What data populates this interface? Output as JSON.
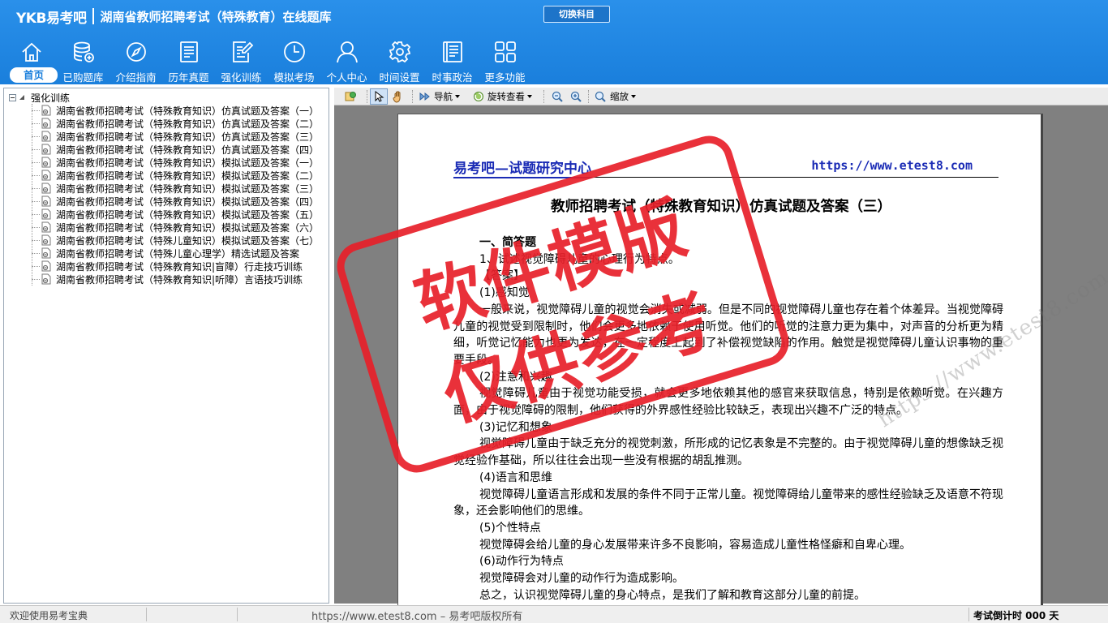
{
  "app": {
    "logo": "YKB易考吧",
    "title": "湖南省教师招聘考试（特殊教育）在线题库",
    "switch_label": "切换科目"
  },
  "nav": [
    {
      "label": "首页",
      "icon": "home-icon"
    },
    {
      "label": "已购题库",
      "icon": "database-icon"
    },
    {
      "label": "介绍指南",
      "icon": "compass-icon"
    },
    {
      "label": "历年真题",
      "icon": "list-document-icon"
    },
    {
      "label": "强化训练",
      "icon": "edit-document-icon"
    },
    {
      "label": "模拟考场",
      "icon": "clock-icon"
    },
    {
      "label": "个人中心",
      "icon": "user-icon"
    },
    {
      "label": "时间设置",
      "icon": "gear-icon"
    },
    {
      "label": "时事政治",
      "icon": "newspaper-icon"
    },
    {
      "label": "更多功能",
      "icon": "grid-icon"
    }
  ],
  "tree": {
    "root": "强化训练",
    "items": [
      "湖南省教师招聘考试（特殊教育知识）仿真试题及答案（一）",
      "湖南省教师招聘考试（特殊教育知识）仿真试题及答案（二）",
      "湖南省教师招聘考试（特殊教育知识）仿真试题及答案（三）",
      "湖南省教师招聘考试（特殊教育知识）仿真试题及答案（四）",
      "湖南省教师招聘考试（特殊教育知识）模拟试题及答案（一）",
      "湖南省教师招聘考试（特殊教育知识）模拟试题及答案（二）",
      "湖南省教师招聘考试（特殊教育知识）模拟试题及答案（三）",
      "湖南省教师招聘考试（特殊教育知识）模拟试题及答案（四）",
      "湖南省教师招聘考试（特殊教育知识）模拟试题及答案（五）",
      "湖南省教师招聘考试（特殊教育知识）模拟试题及答案（六）",
      "湖南省教师招聘考试（特殊儿童知识）模拟试题及答案（七）",
      "湖南省教师招聘考试（特殊儿童心理学）精选试题及答案",
      "湖南省教师招聘考试（特殊教育知识|盲障）行走技巧训练",
      "湖南省教师招聘考试（特殊教育知识|听障）言语技巧训练"
    ]
  },
  "toolbar": {
    "navigate": "导航",
    "rotate": "旋转查看",
    "zoom": "缩放"
  },
  "document": {
    "header_left": "易考吧—试题研究中心",
    "header_right": "https://www.etest8.com",
    "title": "教师招聘考试（特殊教育知识）仿真试题及答案（三）",
    "lines": [
      {
        "type": "sec",
        "text": "一、简答题"
      },
      {
        "type": "sub",
        "text": "1、试述视觉障碍儿童的心理行为特点。"
      },
      {
        "type": "sub",
        "text": "【答案】"
      },
      {
        "type": "sub",
        "text": "(1)感知觉"
      },
      {
        "type": "para",
        "text": "一般来说，视觉障碍儿童的视觉会消失或减弱。但是不同的视觉障碍儿童也存在着个体差异。当视觉障碍儿童的视觉受到限制时，他们会更多地依赖于使用听觉。他们的听觉的注意力更为集中，对声音的分析更为精细，听觉记忆能力也更为发达，在一定程度上起到了补偿视觉缺陷的作用。触觉是视觉障碍儿童认识事物的重要手段。"
      },
      {
        "type": "sub",
        "text": "(2)注意和兴趣"
      },
      {
        "type": "para",
        "text": "视觉障碍儿童由于视觉功能受损，就会更多地依赖其他的感官来获取信息，特别是依赖听觉。在兴趣方面，由于视觉障碍的限制，他们获得的外界感性经验比较缺乏，表现出兴趣不广泛的特点。"
      },
      {
        "type": "sub",
        "text": "(3)记忆和想象"
      },
      {
        "type": "para",
        "text": "视觉障碍儿童由于缺乏充分的视觉刺激，所形成的记忆表象是不完整的。由于视觉障碍儿童的想像缺乏视觉经验作基础，所以往往会出现一些没有根据的胡乱推测。"
      },
      {
        "type": "sub",
        "text": "(4)语言和思维"
      },
      {
        "type": "para",
        "text": "视觉障碍儿童语言形成和发展的条件不同于正常儿童。视觉障碍给儿童带来的感性经验缺乏及语意不符现象，还会影响他们的思维。"
      },
      {
        "type": "sub",
        "text": "(5)个性特点"
      },
      {
        "type": "para",
        "text": "视觉障碍会给儿童的身心发展带来许多不良影响，容易造成儿童性格怪癖和自卑心理。"
      },
      {
        "type": "sub",
        "text": "(6)动作行为特点"
      },
      {
        "type": "para",
        "text": "视觉障碍会对儿童的动作行为造成影响。"
      },
      {
        "type": "para",
        "text": "总之，认识视觉障碍儿童的身心特点，是我们了解和教育这部分儿童的前提。"
      }
    ],
    "watermark": "https://www.etest8.com",
    "stamp_line1": "软件模版",
    "stamp_line2": "仅供参考"
  },
  "status": {
    "welcome": "欢迎使用易考宝典",
    "copyright": "https://www.etest8.com – 易考吧版权所有",
    "countdown": "考试倒计时 000 天"
  },
  "colors": {
    "header": "#1a7fdc",
    "brand_text": "#1a2bb5",
    "stamp": "#e8202a"
  }
}
